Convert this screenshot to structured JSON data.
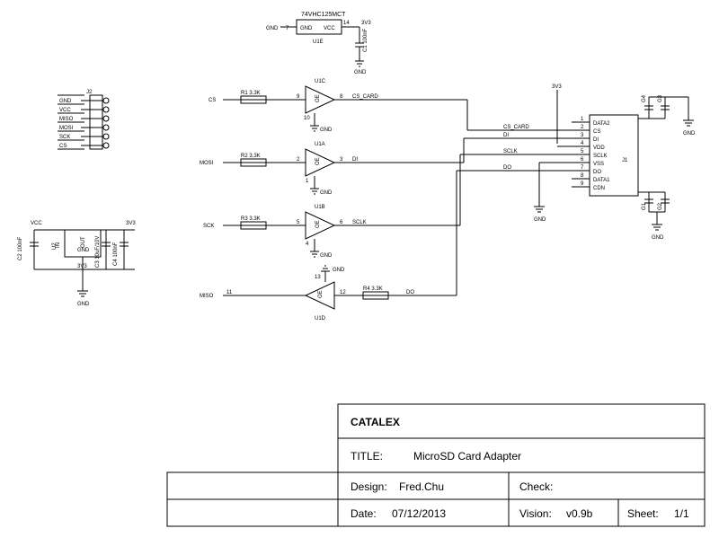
{
  "ic": {
    "part": "74VHC125MCT",
    "gnd_pin": "7",
    "vcc_pin": "14",
    "vcc_net": "3V3",
    "cap": "C1 100nF",
    "ref_e": "U1E",
    "gnd": "GND",
    "vcc": "VCC"
  },
  "buffers": {
    "u1c": {
      "ref": "U1C",
      "in_net": "CS",
      "r": "R1 3.3K",
      "pin_in": "9",
      "pin_oe": "10",
      "pin_out": "8",
      "out_net": "CS_CARD",
      "oe": "OE",
      "gnd": "GND"
    },
    "u1a": {
      "ref": "U1A",
      "in_net": "MOSI",
      "r": "R2 3.3K",
      "pin_in": "2",
      "pin_oe": "1",
      "pin_out": "3",
      "out_net": "DI",
      "oe": "OE",
      "gnd": "GND"
    },
    "u1b": {
      "ref": "U1B",
      "in_net": "SCK",
      "r": "R3 3.3K",
      "pin_in": "5",
      "pin_oe": "4",
      "pin_out": "6",
      "out_net": "SCLK",
      "oe": "OE",
      "gnd": "GND"
    },
    "u1d": {
      "ref": "U1D",
      "in_net": "MISO",
      "r": "R4 3.3K",
      "pin_in": "11",
      "pin_oe": "13",
      "pin_out": "12",
      "out_net": "DO",
      "oe": "OE",
      "gnd": "GND"
    }
  },
  "j2": {
    "ref": "J2",
    "pins": [
      "GND",
      "VCC",
      "MISO",
      "MOSI",
      "SCK",
      "CS"
    ]
  },
  "reg": {
    "vcc": "VCC",
    "v33": "3V3",
    "gnd": "GND",
    "c2": "C2 100nF",
    "c3": "C3 10uF/10V",
    "c4": "C4 100nF",
    "u2": "U2",
    "in": "IN",
    "out": "OUT",
    "g": "GND",
    "tab": "3V3"
  },
  "j1": {
    "ref": "J1",
    "v33": "3V3",
    "gnd": "GND",
    "pins": [
      {
        "n": "1",
        "name": "DATA2"
      },
      {
        "n": "2",
        "name": "CS"
      },
      {
        "n": "3",
        "name": "DI"
      },
      {
        "n": "4",
        "name": "VDD"
      },
      {
        "n": "5",
        "name": "SCLK"
      },
      {
        "n": "6",
        "name": "VSS"
      },
      {
        "n": "7",
        "name": "DO"
      },
      {
        "n": "8",
        "name": "DATA1"
      },
      {
        "n": "9",
        "name": "CDN"
      }
    ],
    "nets": {
      "cs": "CS_CARD",
      "di": "DI",
      "sclk": "SCLK",
      "do": "DO"
    },
    "caps": {
      "g1": "G1",
      "g2": "G2",
      "g3": "G3",
      "g4": "G4"
    }
  },
  "title_block": {
    "brand": "CATALEX",
    "title_k": "TITLE:",
    "title_v": "MicroSD Card Adapter",
    "design_k": "Design:",
    "design_v": "Fred.Chu",
    "check_k": "Check:",
    "date_k": "Date:",
    "date_v": "07/12/2013",
    "vision_k": "Vision:",
    "vision_v": "v0.9b",
    "sheet_k": "Sheet:",
    "sheet_v": "1/1"
  }
}
